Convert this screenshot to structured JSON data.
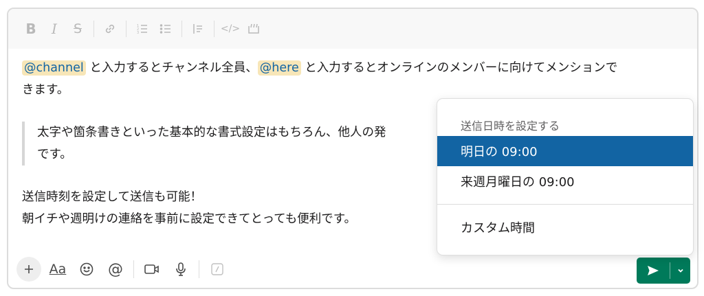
{
  "toolbar": {
    "items": [
      {
        "name": "bold-icon",
        "glyph": "B"
      },
      {
        "name": "italic-icon",
        "glyph": "I"
      },
      {
        "name": "strikethrough-icon",
        "glyph": "S"
      },
      {
        "name": "link-icon"
      },
      {
        "name": "ordered-list-icon"
      },
      {
        "name": "bulleted-list-icon"
      },
      {
        "name": "blockquote-icon"
      },
      {
        "name": "code-icon",
        "glyph": "</>"
      },
      {
        "name": "code-block-icon"
      }
    ]
  },
  "message": {
    "line1": {
      "mention1": "@channel",
      "text1": " と入力するとチャンネル全員、",
      "mention2": "@here",
      "text2": " と入力するとオンラインのメンバーに向けてメンションで",
      "text3": "きます。"
    },
    "quote": {
      "line1": "太字や箇条書きといった基本的な書式設定はもちろん、他人の発",
      "line2": "です。"
    },
    "para3": {
      "line1": "送信時刻を設定して送信も可能！",
      "line2": "朝イチや週明けの連絡を事前に設定できてとっても便利です。"
    }
  },
  "bottom_bar": {
    "format_label": "Aa",
    "icons": [
      "plus-icon",
      "format-icon",
      "emoji-icon",
      "mention-icon",
      "video-icon",
      "microphone-icon",
      "slash-command-icon"
    ]
  },
  "schedule_menu": {
    "title": "送信日時を設定する",
    "options": [
      {
        "label": "明日の 09:00",
        "selected": true
      },
      {
        "label": "来週月曜日の 09:00",
        "selected": false
      },
      {
        "label": "カスタム時間",
        "selected": false
      }
    ]
  },
  "colors": {
    "send_button": "#007a5a",
    "selected_option": "#1264a3",
    "mention_highlight": "#f7e6b8"
  }
}
